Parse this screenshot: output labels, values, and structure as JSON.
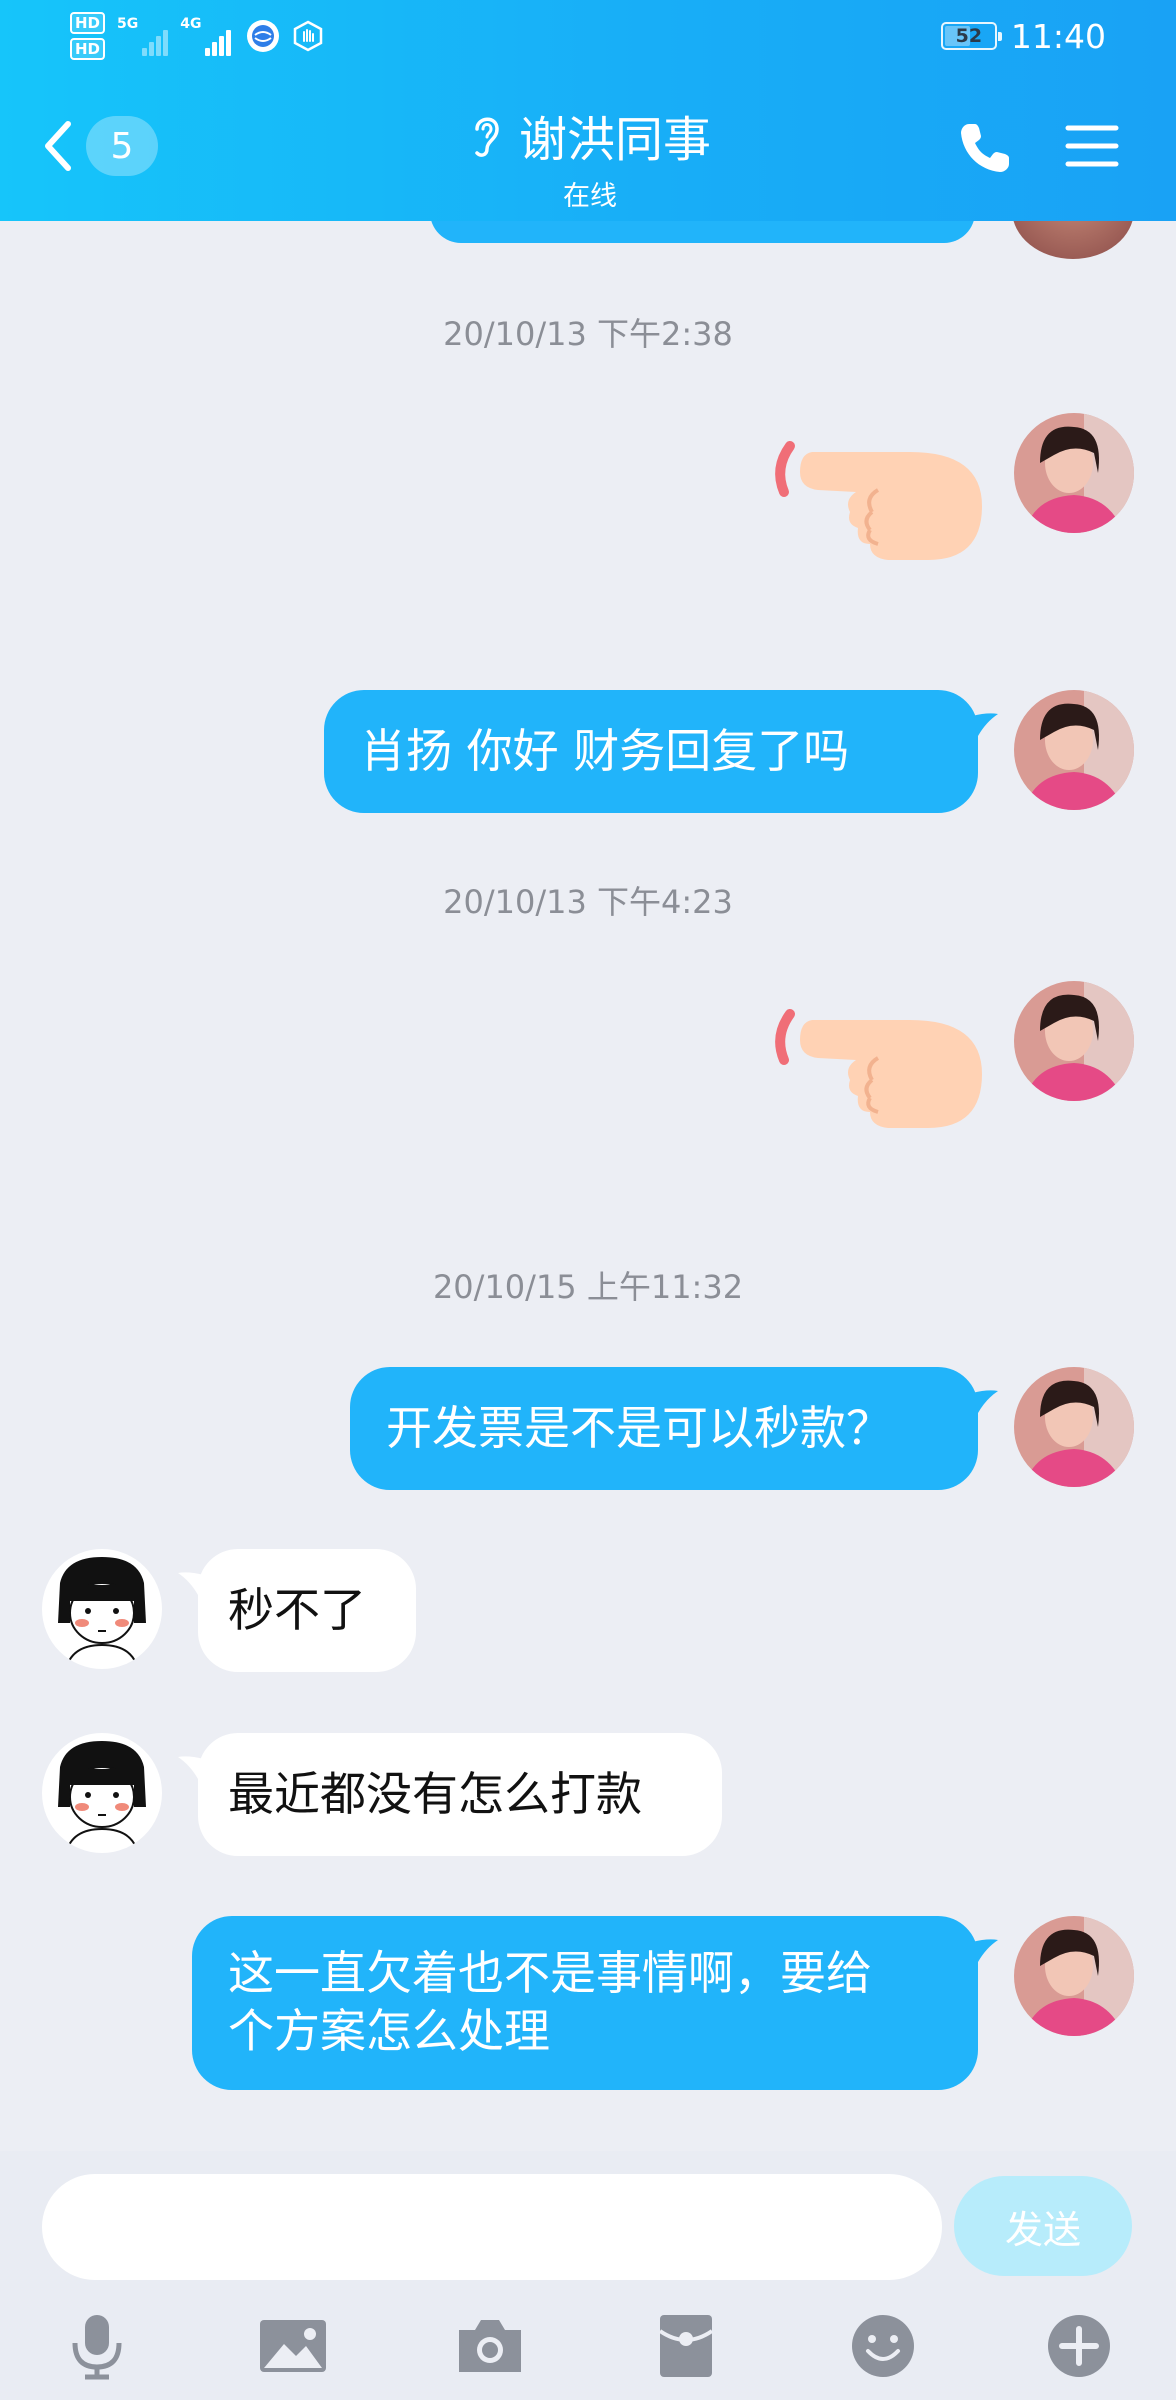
{
  "status_bar": {
    "hd1": "HD",
    "hd2": "HD",
    "net1": "5G",
    "net2": "4G",
    "battery": "52",
    "battery_level": 0.52,
    "time": "11:40"
  },
  "header": {
    "unread_count": "5",
    "contact_name": "谢洪同事",
    "contact_status": "在线",
    "icons": [
      "back-arrow-icon",
      "ear-icon",
      "phone-icon",
      "menu-icon"
    ]
  },
  "messages": [
    {
      "type": "timestamp",
      "text": "20/10/13 下午2:38"
    },
    {
      "type": "sticker",
      "from": "me",
      "sticker": "pointing-hand"
    },
    {
      "type": "text",
      "from": "me",
      "text": "肖扬   你好   财务回复了吗"
    },
    {
      "type": "timestamp",
      "text": "20/10/13 下午4:23"
    },
    {
      "type": "sticker",
      "from": "me",
      "sticker": "pointing-hand"
    },
    {
      "type": "timestamp",
      "text": "20/10/15 上午11:32"
    },
    {
      "type": "text",
      "from": "me",
      "text": "开发票是不是可以秒款？"
    },
    {
      "type": "text",
      "from": "them",
      "text": "秒不了"
    },
    {
      "type": "text",
      "from": "them",
      "text": "最近都没有怎么打款"
    },
    {
      "type": "text",
      "from": "me",
      "lines": [
        "这一直欠着也不是事情啊，要给",
        "个方案怎么处理"
      ]
    }
  ],
  "input": {
    "value": "",
    "placeholder": "",
    "send_label": "发送"
  },
  "toolbar": [
    "mic-icon",
    "image-icon",
    "camera-icon",
    "red-packet-icon",
    "emoji-icon",
    "plus-icon"
  ],
  "colors": {
    "header_gradient": [
      "#16c5fa",
      "#19a2f5"
    ],
    "bubble_out": "#21b4fa",
    "bubble_in": "#ffffff",
    "background": "#eceef4",
    "send_button": "#b7ecfb",
    "timestamp": "#8b8e96"
  }
}
